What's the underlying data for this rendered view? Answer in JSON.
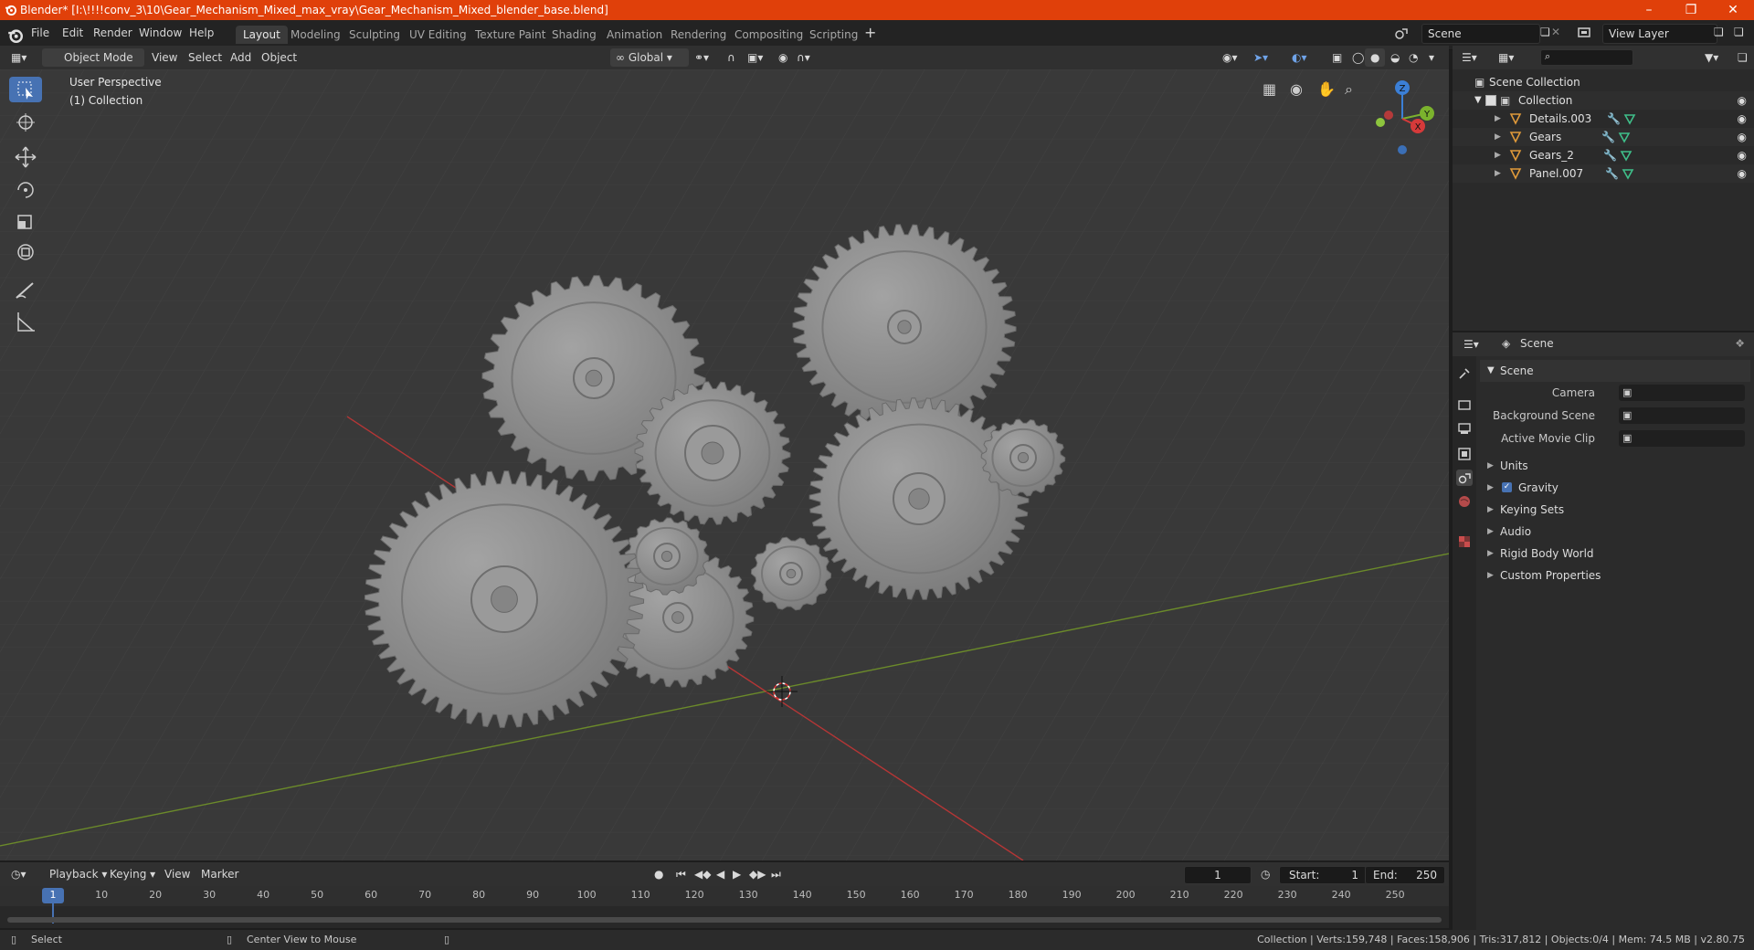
{
  "titlebar": {
    "title": "Blender* [I:\\!!!!conv_3\\10\\Gear_Mechanism_Mixed_max_vray\\Gear_Mechanism_Mixed_blender_base.blend]"
  },
  "menu": [
    "File",
    "Edit",
    "Render",
    "Window",
    "Help"
  ],
  "workspaces": [
    "Layout",
    "Modeling",
    "Sculpting",
    "UV Editing",
    "Texture Paint",
    "Shading",
    "Animation",
    "Rendering",
    "Compositing",
    "Scripting"
  ],
  "scene_field": "Scene",
  "view_layer_field": "View Layer",
  "viewport_header": {
    "mode": "Object Mode",
    "menus": [
      "View",
      "Select",
      "Add",
      "Object"
    ],
    "transform": "Global"
  },
  "viewport": {
    "perspective": "User Perspective",
    "collection": "(1) Collection",
    "gizmo_axes": {
      "z": "Z",
      "y": "Y",
      "x": "X"
    }
  },
  "outliner": {
    "root": "Scene Collection",
    "collection": "Collection",
    "items": [
      "Details.003",
      "Gears",
      "Gears_2",
      "Panel.007"
    ]
  },
  "properties": {
    "context": "Scene",
    "panel_title": "Scene",
    "fields": [
      {
        "label": "Camera"
      },
      {
        "label": "Background Scene"
      },
      {
        "label": "Active Movie Clip"
      }
    ],
    "sections": [
      "Units",
      "Gravity",
      "Keying Sets",
      "Audio",
      "Rigid Body World",
      "Custom Properties"
    ]
  },
  "timeline": {
    "menus": [
      "Playback",
      "Keying",
      "View",
      "Marker"
    ],
    "current_frame": "1",
    "start_label": "Start:",
    "start": "1",
    "end_label": "End:",
    "end": "250",
    "ticks": [
      "1",
      "10",
      "20",
      "30",
      "40",
      "50",
      "60",
      "70",
      "80",
      "90",
      "100",
      "110",
      "120",
      "130",
      "140",
      "150",
      "160",
      "170",
      "180",
      "190",
      "200",
      "210",
      "220",
      "230",
      "240",
      "250"
    ]
  },
  "status": {
    "left": "Select",
    "middle": "Center View to Mouse",
    "right": "Collection | Verts:159,748 | Faces:158,906 | Tris:317,812 | Objects:0/4 | Mem: 74.5 MB | v2.80.75"
  },
  "colors": {
    "titlebar": "#e0400a",
    "accent": "#4772b3",
    "gear": "#8a8a8a"
  }
}
